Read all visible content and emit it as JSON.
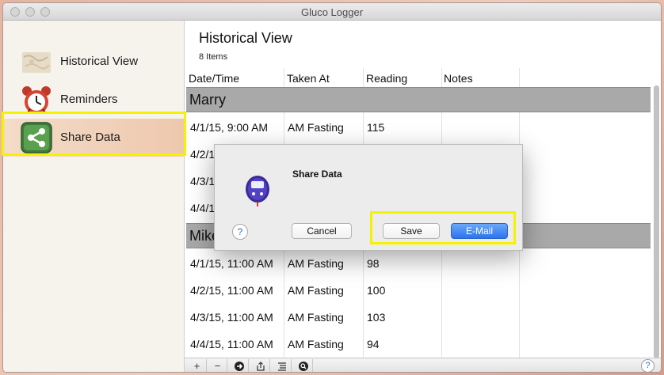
{
  "window": {
    "title": "Gluco Logger"
  },
  "sidebar": {
    "items": [
      {
        "label": "Historical View",
        "icon": "map-icon"
      },
      {
        "label": "Reminders",
        "icon": "alarm-clock-icon"
      },
      {
        "label": "Share Data",
        "icon": "share-icon",
        "selected": true
      }
    ]
  },
  "content": {
    "title": "Historical View",
    "item_count": "8 Items",
    "columns": [
      "Date/Time",
      "Taken At",
      "Reading",
      "Notes"
    ],
    "groups": [
      {
        "name": "Marry",
        "rows": [
          {
            "datetime": "4/1/15, 9:00 AM",
            "taken_at": "AM Fasting",
            "reading": "115",
            "notes": ""
          },
          {
            "datetime": "4/2/1",
            "taken_at": "",
            "reading": "",
            "notes": ""
          },
          {
            "datetime": "4/3/1",
            "taken_at": "",
            "reading": "",
            "notes": ""
          },
          {
            "datetime": "4/4/1",
            "taken_at": "",
            "reading": "",
            "notes": ""
          }
        ]
      },
      {
        "name": "Mike",
        "rows": [
          {
            "datetime": "4/1/15, 11:00 AM",
            "taken_at": "AM Fasting",
            "reading": "98",
            "notes": ""
          },
          {
            "datetime": "4/2/15, 11:00 AM",
            "taken_at": "AM Fasting",
            "reading": "100",
            "notes": ""
          },
          {
            "datetime": "4/3/15, 11:00 AM",
            "taken_at": "AM Fasting",
            "reading": "103",
            "notes": ""
          },
          {
            "datetime": "4/4/15, 11:00 AM",
            "taken_at": "AM Fasting",
            "reading": "94",
            "notes": ""
          }
        ]
      }
    ]
  },
  "toolbar": {
    "add": "+",
    "remove": "−",
    "help": "?"
  },
  "dialog": {
    "title": "Share Data",
    "help": "?",
    "cancel": "Cancel",
    "save": "Save",
    "email": "E-Mail"
  },
  "colors": {
    "highlight": "#f5f200",
    "group_header": "#a9a9a9",
    "primary_button": "#2d74ec"
  }
}
